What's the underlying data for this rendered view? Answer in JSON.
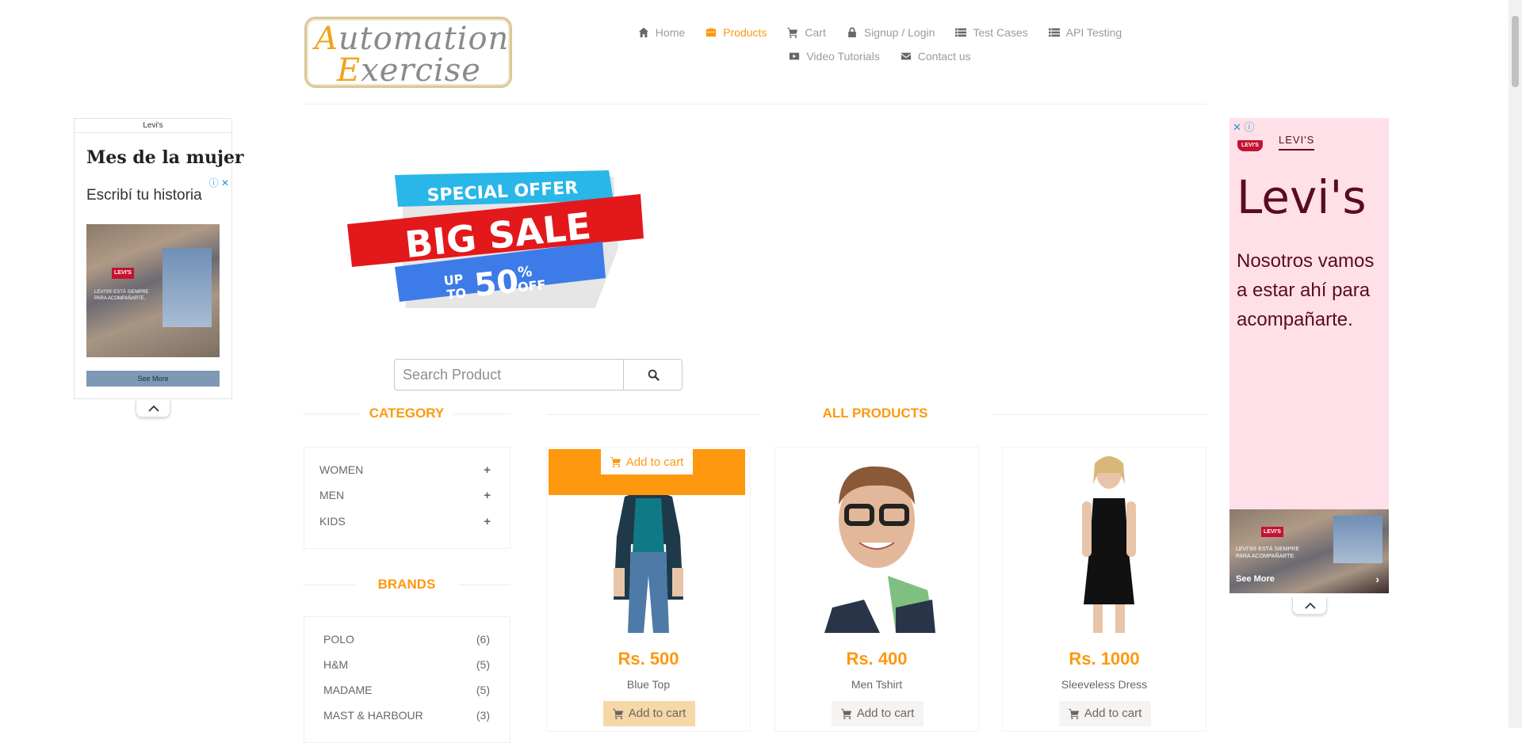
{
  "logo": {
    "line1_cap": "A",
    "line1_rest": "utomation",
    "line2_cap": "E",
    "line2_rest": "xercise"
  },
  "nav": {
    "row1": [
      {
        "label": "Home",
        "icon": "home-icon",
        "active": false
      },
      {
        "label": "Products",
        "icon": "briefcase-icon",
        "active": true
      },
      {
        "label": "Cart",
        "icon": "cart-icon",
        "active": false
      },
      {
        "label": "Signup / Login",
        "icon": "lock-icon",
        "active": false
      },
      {
        "label": "Test Cases",
        "icon": "list-icon",
        "active": false
      },
      {
        "label": "API Testing",
        "icon": "list-icon",
        "active": false
      }
    ],
    "row2": [
      {
        "label": "Video Tutorials",
        "icon": "youtube-icon",
        "active": false
      },
      {
        "label": "Contact us",
        "icon": "envelope-icon",
        "active": false
      }
    ]
  },
  "ad_left": {
    "top_label": "Levi's",
    "headline": "Mes de la mujer",
    "sub": "Escribí tu historia",
    "badge": "LEVI'S",
    "caption": "LEVI'S® ESTÁ SIEMPRE PARA ACOMPAÑARTE.",
    "see_more": "See More"
  },
  "ad_right": {
    "brand": "LEVI'S",
    "logo": "LEVI'S",
    "big": "Levi's",
    "body": "Nosotros vamos a estar ahí para acompañarte.",
    "badge": "LEVI'S",
    "caption": "LEVI'S® ESTÁ SIEMPRE PARA ACOMPAÑARTE.",
    "see_more": "See More"
  },
  "banner": {
    "line1": "SPECIAL OFFER",
    "line2": "BIG SALE",
    "up": "UP",
    "to": "TO",
    "percent": "50",
    "pct_sign": "%",
    "off": "OFF"
  },
  "search": {
    "placeholder": "Search Product"
  },
  "category": {
    "title": "Category",
    "items": [
      {
        "label": "Women"
      },
      {
        "label": "Men"
      },
      {
        "label": "Kids"
      }
    ]
  },
  "brands": {
    "title": "Brands",
    "items": [
      {
        "name": "POLO",
        "count": "(6)"
      },
      {
        "name": "H&M",
        "count": "(5)"
      },
      {
        "name": "MADAME",
        "count": "(5)"
      },
      {
        "name": "MAST & HARBOUR",
        "count": "(3)"
      }
    ]
  },
  "products": {
    "title": "All Products",
    "add_label": "Add to cart",
    "items": [
      {
        "name": "Blue Top",
        "price": "Rs. 500"
      },
      {
        "name": "Men Tshirt",
        "price": "Rs. 400"
      },
      {
        "name": "Sleeveless Dress",
        "price": "Rs. 1000"
      }
    ]
  },
  "colors": {
    "accent": "#fe980f",
    "text": "#696763",
    "levis_red": "#c41230",
    "levis_ad_bg": "#ffe0e8"
  }
}
